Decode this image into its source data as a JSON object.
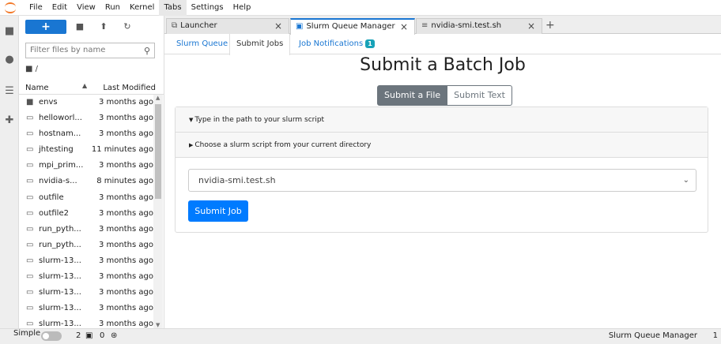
{
  "menu": [
    "File",
    "Edit",
    "View",
    "Run",
    "Kernel",
    "Tabs",
    "Settings",
    "Help"
  ],
  "active_menu": "Tabs",
  "filebrowser": {
    "new_label": "+",
    "filter_placeholder": "Filter files by name",
    "breadcrumb": "/",
    "col_name": "Name",
    "col_modified": "Last Modified",
    "files": [
      {
        "name": "envs",
        "modified": "3 months ago",
        "type": "folder"
      },
      {
        "name": "helloworl...",
        "modified": "3 months ago",
        "type": "file"
      },
      {
        "name": "hostnam...",
        "modified": "3 months ago",
        "type": "file"
      },
      {
        "name": "jhtesting",
        "modified": "11 minutes ago",
        "type": "file"
      },
      {
        "name": "mpi_prim...",
        "modified": "3 months ago",
        "type": "file"
      },
      {
        "name": "nvidia-s...",
        "modified": "8 minutes ago",
        "type": "file"
      },
      {
        "name": "outfile",
        "modified": "3 months ago",
        "type": "file"
      },
      {
        "name": "outfile2",
        "modified": "3 months ago",
        "type": "file"
      },
      {
        "name": "run_pyth...",
        "modified": "3 months ago",
        "type": "file"
      },
      {
        "name": "run_pyth...",
        "modified": "3 months ago",
        "type": "file"
      },
      {
        "name": "slurm-13...",
        "modified": "3 months ago",
        "type": "file"
      },
      {
        "name": "slurm-13...",
        "modified": "3 months ago",
        "type": "file"
      },
      {
        "name": "slurm-13...",
        "modified": "3 months ago",
        "type": "file"
      },
      {
        "name": "slurm-13...",
        "modified": "3 months ago",
        "type": "file"
      },
      {
        "name": "slurm-13...",
        "modified": "3 months ago",
        "type": "file"
      }
    ]
  },
  "tabs": [
    {
      "label": "Launcher",
      "icon": "launcher-icon"
    },
    {
      "label": "Slurm Queue Manager",
      "icon": "slurm-icon"
    },
    {
      "label": "nvidia-smi.test.sh",
      "icon": "text-file-icon"
    }
  ],
  "subtabs": {
    "queue": "Slurm Queue",
    "submit": "Submit Jobs",
    "notifications": "Job Notifications",
    "notifications_count": "1"
  },
  "form": {
    "title": "Submit a Batch Job",
    "seg_file": "Submit a File",
    "seg_text": "Submit Text",
    "acc_path": "Type in the path to your slurm script",
    "acc_choose": "Choose a slurm script from your current directory",
    "selected_script": "nvidia-smi.test.sh",
    "submit_label": "Submit Job"
  },
  "statusbar": {
    "simple_label": "Simple",
    "terminals": "2",
    "kernels": "0",
    "right_label": "Slurm Queue Manager",
    "right_count": "1"
  }
}
